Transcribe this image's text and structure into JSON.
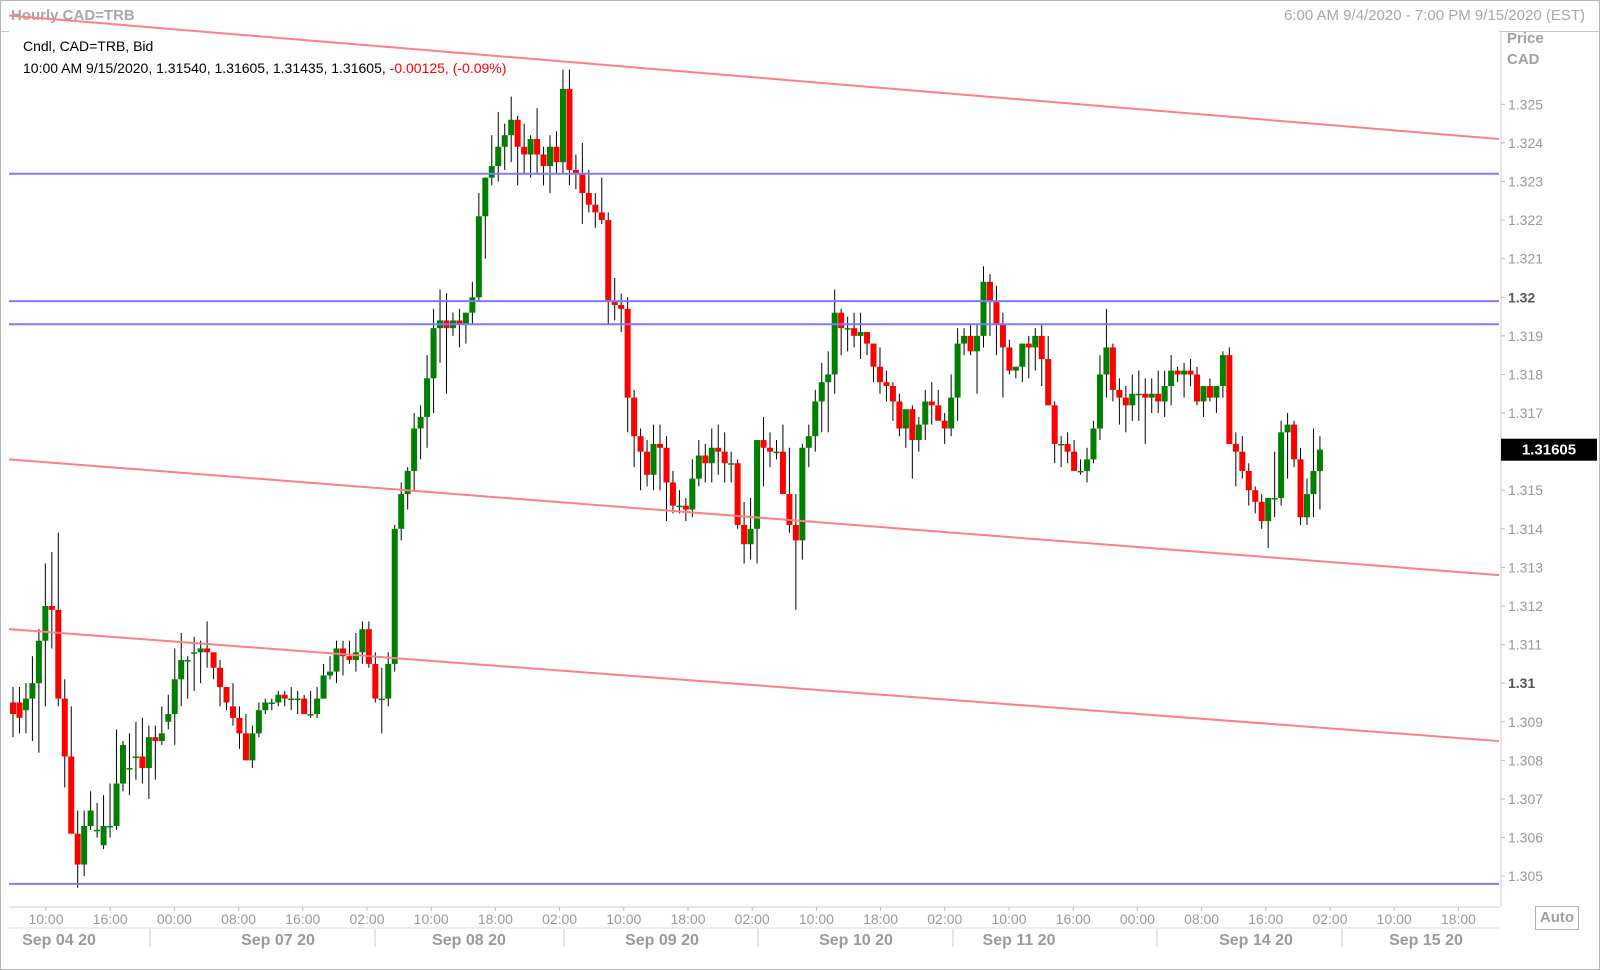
{
  "window": {
    "title": "Hourly CAD=TRB",
    "range_label": "6:00 AM 9/4/2020 - 7:00 PM 9/15/2020 (EST)"
  },
  "legend": {
    "line1": "Cndl, CAD=TRB, Bid",
    "line2_black": "10:00 AM 9/15/2020, 1.31540, 1.31605, 1.31435, 1.31605,",
    "line2_red": "-0.00125, (-0.09%)"
  },
  "axis": {
    "title_line1": "Price",
    "title_line2": "CAD",
    "last_price": "1.31605",
    "auto_label": "Auto"
  },
  "colors": {
    "up": "#008000",
    "down": "#ff0000",
    "support_line": "#7b7bff",
    "channel_line": "#ff8080",
    "last_price_bg": "#000000"
  },
  "chart_data": {
    "type": "candlestick",
    "title": "Hourly CAD=TRB",
    "ylabel": "Price CAD",
    "ylim": [
      1.3042,
      1.3269
    ],
    "y_ticks": [
      "1.305",
      "1.306",
      "1.307",
      "1.308",
      "1.309",
      "1.31",
      "1.311",
      "1.312",
      "1.313",
      "1.314",
      "1.315",
      "1.316",
      "1.317",
      "1.318",
      "1.319",
      "1.32",
      "1.321",
      "1.322",
      "1.323",
      "1.324",
      "1.325"
    ],
    "x_time_labels": [
      "10:00",
      "16:00",
      "00:00",
      "08:00",
      "16:00",
      "02:00",
      "10:00",
      "18:00",
      "02:00",
      "10:00",
      "18:00",
      "02:00",
      "10:00",
      "18:00",
      "02:00",
      "10:00",
      "16:00",
      "00:00",
      "08:00",
      "16:00",
      "02:00",
      "10:00",
      "18:00"
    ],
    "x_date_labels": [
      "Sep 04 20",
      "Sep 07 20",
      "Sep 08 20",
      "Sep 09 20",
      "Sep 10 20",
      "Sep 11 20",
      "Sep 14 20",
      "Sep 15 20"
    ],
    "horizontal_lines": [
      1.3232,
      1.3199,
      1.3193,
      1.3048
    ],
    "trend_lines": [
      {
        "start": [
          "Sep 04 08:00",
          1.3273
        ],
        "end": [
          "Sep 15 19:00",
          1.3241
        ]
      },
      {
        "start": [
          "Sep 04 08:00",
          1.3158
        ],
        "end": [
          "Sep 15 19:00",
          1.3128
        ]
      },
      {
        "start": [
          "Sep 04 08:00",
          1.3114
        ],
        "end": [
          "Sep 15 19:00",
          1.3085
        ]
      }
    ],
    "last_value": 1.31605,
    "ohlc": [
      [
        1.3095,
        1.3099,
        1.3086,
        1.3092
      ],
      [
        1.3095,
        1.3099,
        1.3087,
        1.3091
      ],
      [
        1.3093,
        1.31,
        1.3087,
        1.3096
      ],
      [
        1.3096,
        1.3107,
        1.3085,
        1.31
      ],
      [
        1.31,
        1.3114,
        1.3082,
        1.3111
      ],
      [
        1.3111,
        1.3131,
        1.3094,
        1.312
      ],
      [
        1.312,
        1.3134,
        1.3109,
        1.3119
      ],
      [
        1.3119,
        1.3139,
        1.3094,
        1.3096
      ],
      [
        1.3096,
        1.3101,
        1.3073,
        1.3081
      ],
      [
        1.3081,
        1.3094,
        1.3063,
        1.3061
      ],
      [
        1.3061,
        1.3067,
        1.3047,
        1.3053
      ],
      [
        1.3053,
        1.3067,
        1.305,
        1.3063
      ],
      [
        1.3063,
        1.3072,
        1.3062,
        1.3067
      ],
      [
        1.3062,
        1.3069,
        1.306,
        1.3062
      ],
      [
        1.3058,
        1.3071,
        1.3057,
        1.3063
      ],
      [
        1.3063,
        1.3074,
        1.306,
        1.3063
      ],
      [
        1.3063,
        1.3088,
        1.3062,
        1.3074
      ],
      [
        1.3074,
        1.3085,
        1.3072,
        1.3084
      ],
      [
        1.3078,
        1.3087,
        1.3071,
        1.3078
      ],
      [
        1.3081,
        1.309,
        1.3075,
        1.3081
      ],
      [
        1.3081,
        1.3091,
        1.3074,
        1.3078
      ],
      [
        1.3078,
        1.3089,
        1.307,
        1.3086
      ],
      [
        1.3086,
        1.3089,
        1.3075,
        1.3085
      ],
      [
        1.3085,
        1.3094,
        1.3084,
        1.3087
      ],
      [
        1.309,
        1.3097,
        1.3088,
        1.3092
      ],
      [
        1.3092,
        1.3109,
        1.3084,
        1.3101
      ],
      [
        1.3101,
        1.3113,
        1.3094,
        1.3106
      ],
      [
        1.3106,
        1.3107,
        1.3096,
        1.3106
      ],
      [
        1.3108,
        1.3112,
        1.3098,
        1.3108
      ],
      [
        1.3108,
        1.3111,
        1.31,
        1.3109
      ],
      [
        1.3109,
        1.3116,
        1.3104,
        1.3108
      ],
      [
        1.3108,
        1.3108,
        1.3101,
        1.3104
      ],
      [
        1.3104,
        1.3106,
        1.3094,
        1.3099
      ],
      [
        1.3099,
        1.3099,
        1.3093,
        1.3095
      ],
      [
        1.3094,
        1.31,
        1.3089,
        1.3091
      ],
      [
        1.3091,
        1.3094,
        1.3083,
        1.3087
      ],
      [
        1.3087,
        1.3092,
        1.308,
        1.308
      ],
      [
        1.308,
        1.3089,
        1.3078,
        1.3087
      ],
      [
        1.3087,
        1.3095,
        1.3086,
        1.3093
      ],
      [
        1.3093,
        1.3096,
        1.3092,
        1.3095
      ],
      [
        1.3095,
        1.3096,
        1.3093,
        1.3095
      ],
      [
        1.3095,
        1.3098,
        1.3094,
        1.3097
      ],
      [
        1.3097,
        1.3098,
        1.3094,
        1.3096
      ],
      [
        1.3096,
        1.3099,
        1.3093,
        1.3096
      ],
      [
        1.3096,
        1.3098,
        1.3092,
        1.3096
      ],
      [
        1.3096,
        1.3097,
        1.3092,
        1.3092
      ],
      [
        1.3092,
        1.3098,
        1.3091,
        1.3092
      ],
      [
        1.3092,
        1.3099,
        1.3091,
        1.3096
      ],
      [
        1.3096,
        1.3105,
        1.3096,
        1.3102
      ],
      [
        1.3102,
        1.3107,
        1.3101,
        1.3103
      ],
      [
        1.3103,
        1.3111,
        1.31,
        1.3109
      ],
      [
        1.3109,
        1.3111,
        1.3102,
        1.3107
      ],
      [
        1.3107,
        1.3111,
        1.3105,
        1.3106
      ],
      [
        1.3106,
        1.3113,
        1.3103,
        1.3108
      ],
      [
        1.3108,
        1.3116,
        1.3105,
        1.3114
      ],
      [
        1.3114,
        1.3116,
        1.3104,
        1.3105
      ],
      [
        1.3105,
        1.3108,
        1.3095,
        1.3096
      ],
      [
        1.3096,
        1.3104,
        1.3087,
        1.3096
      ],
      [
        1.3096,
        1.3108,
        1.3094,
        1.3105
      ],
      [
        1.3105,
        1.3141,
        1.3103,
        1.314
      ],
      [
        1.314,
        1.3152,
        1.3137,
        1.3149
      ],
      [
        1.3149,
        1.3156,
        1.3145,
        1.3155
      ],
      [
        1.3155,
        1.317,
        1.315,
        1.3166
      ],
      [
        1.3166,
        1.3172,
        1.3158,
        1.3169
      ],
      [
        1.3169,
        1.3185,
        1.3161,
        1.3179
      ],
      [
        1.3179,
        1.3197,
        1.317,
        1.3192
      ],
      [
        1.3192,
        1.3202,
        1.3183,
        1.3194
      ],
      [
        1.3194,
        1.3201,
        1.3175,
        1.3192
      ],
      [
        1.3192,
        1.3196,
        1.319,
        1.3194
      ],
      [
        1.3194,
        1.3197,
        1.3187,
        1.3193
      ],
      [
        1.3193,
        1.3196,
        1.3188,
        1.3196
      ],
      [
        1.3196,
        1.3204,
        1.3193,
        1.32
      ],
      [
        1.32,
        1.3227,
        1.3199,
        1.3221
      ],
      [
        1.3221,
        1.3231,
        1.321,
        1.3231
      ],
      [
        1.3231,
        1.3242,
        1.3229,
        1.3234
      ],
      [
        1.3234,
        1.3248,
        1.323,
        1.3239
      ],
      [
        1.3239,
        1.3245,
        1.3233,
        1.3242
      ],
      [
        1.3242,
        1.3252,
        1.3235,
        1.3246
      ],
      [
        1.3246,
        1.3247,
        1.3229,
        1.3239
      ],
      [
        1.3239,
        1.3245,
        1.3232,
        1.3237
      ],
      [
        1.3237,
        1.3242,
        1.3231,
        1.3241
      ],
      [
        1.3241,
        1.3249,
        1.3232,
        1.3237
      ],
      [
        1.3237,
        1.3239,
        1.3229,
        1.3234
      ],
      [
        1.3234,
        1.3242,
        1.3227,
        1.3239
      ],
      [
        1.3239,
        1.3243,
        1.3232,
        1.3235
      ],
      [
        1.3235,
        1.3259,
        1.3232,
        1.3254
      ],
      [
        1.3254,
        1.3259,
        1.3229,
        1.3233
      ],
      [
        1.3233,
        1.3237,
        1.3228,
        1.3232
      ],
      [
        1.3232,
        1.324,
        1.3219,
        1.3227
      ],
      [
        1.3227,
        1.3233,
        1.3222,
        1.3224
      ],
      [
        1.3224,
        1.3227,
        1.3218,
        1.3222
      ],
      [
        1.3222,
        1.3231,
        1.3219,
        1.322
      ],
      [
        1.322,
        1.3222,
        1.3193,
        1.3199
      ],
      [
        1.3199,
        1.3205,
        1.3194,
        1.3198
      ],
      [
        1.3198,
        1.3201,
        1.3191,
        1.3197
      ],
      [
        1.3197,
        1.32,
        1.3165,
        1.3174
      ],
      [
        1.3174,
        1.3176,
        1.3156,
        1.3164
      ],
      [
        1.3164,
        1.3166,
        1.315,
        1.316
      ],
      [
        1.316,
        1.3163,
        1.3151,
        1.3154
      ],
      [
        1.3154,
        1.3167,
        1.315,
        1.3162
      ],
      [
        1.3162,
        1.3167,
        1.315,
        1.3161
      ],
      [
        1.3161,
        1.3164,
        1.3142,
        1.3152
      ],
      [
        1.3152,
        1.3155,
        1.3144,
        1.3146
      ],
      [
        1.3146,
        1.315,
        1.3144,
        1.3146
      ],
      [
        1.3146,
        1.3148,
        1.3142,
        1.3145
      ],
      [
        1.3145,
        1.3158,
        1.3143,
        1.3153
      ],
      [
        1.3153,
        1.3163,
        1.3151,
        1.3159
      ],
      [
        1.3159,
        1.3162,
        1.3152,
        1.3157
      ],
      [
        1.3157,
        1.3166,
        1.3152,
        1.3161
      ],
      [
        1.3161,
        1.3167,
        1.3154,
        1.316
      ],
      [
        1.316,
        1.3165,
        1.3152,
        1.3157
      ],
      [
        1.3157,
        1.316,
        1.3152,
        1.3157
      ],
      [
        1.3157,
        1.3158,
        1.314,
        1.3141
      ],
      [
        1.3141,
        1.3147,
        1.3131,
        1.3136
      ],
      [
        1.3136,
        1.3148,
        1.3132,
        1.314
      ],
      [
        1.314,
        1.3152,
        1.3131,
        1.3163
      ],
      [
        1.3163,
        1.3169,
        1.3151,
        1.3161
      ],
      [
        1.3161,
        1.3165,
        1.3156,
        1.316
      ],
      [
        1.316,
        1.3163,
        1.3158,
        1.316
      ],
      [
        1.316,
        1.3167,
        1.3151,
        1.3149
      ],
      [
        1.3149,
        1.3161,
        1.3139,
        1.3141
      ],
      [
        1.3141,
        1.3149,
        1.3119,
        1.3137
      ],
      [
        1.3137,
        1.3162,
        1.3132,
        1.3161
      ],
      [
        1.3161,
        1.3167,
        1.3156,
        1.3164
      ],
      [
        1.3164,
        1.3176,
        1.316,
        1.3173
      ],
      [
        1.3173,
        1.3183,
        1.3165,
        1.3178
      ],
      [
        1.3178,
        1.3186,
        1.3165,
        1.318
      ],
      [
        1.318,
        1.3202,
        1.3175,
        1.3196
      ],
      [
        1.3196,
        1.3197,
        1.3185,
        1.3192
      ],
      [
        1.3192,
        1.3195,
        1.3186,
        1.3192
      ],
      [
        1.3192,
        1.3196,
        1.3187,
        1.319
      ],
      [
        1.319,
        1.3196,
        1.3184,
        1.3191
      ],
      [
        1.3191,
        1.3191,
        1.3185,
        1.3188
      ],
      [
        1.3188,
        1.3188,
        1.3178,
        1.3182
      ],
      [
        1.3182,
        1.3187,
        1.3175,
        1.3178
      ],
      [
        1.3178,
        1.3181,
        1.3173,
        1.3177
      ],
      [
        1.3177,
        1.3178,
        1.3168,
        1.3173
      ],
      [
        1.3173,
        1.3175,
        1.3164,
        1.3166
      ],
      [
        1.3166,
        1.317,
        1.3161,
        1.3171
      ],
      [
        1.3171,
        1.3172,
        1.3153,
        1.3163
      ],
      [
        1.3163,
        1.3169,
        1.316,
        1.3167
      ],
      [
        1.3167,
        1.3176,
        1.3163,
        1.3173
      ],
      [
        1.3173,
        1.3178,
        1.3167,
        1.3172
      ],
      [
        1.3172,
        1.3176,
        1.3168,
        1.3168
      ],
      [
        1.3168,
        1.317,
        1.3162,
        1.3166
      ],
      [
        1.3166,
        1.318,
        1.3164,
        1.3174
      ],
      [
        1.3174,
        1.3192,
        1.3168,
        1.3188
      ],
      [
        1.3188,
        1.3192,
        1.3185,
        1.319
      ],
      [
        1.319,
        1.3193,
        1.3185,
        1.3186
      ],
      [
        1.3186,
        1.3193,
        1.3175,
        1.319
      ],
      [
        1.319,
        1.3208,
        1.3187,
        1.3204
      ],
      [
        1.3204,
        1.3206,
        1.319,
        1.3199
      ],
      [
        1.3199,
        1.3203,
        1.3185,
        1.3193
      ],
      [
        1.3193,
        1.3196,
        1.3174,
        1.3187
      ],
      [
        1.3187,
        1.3189,
        1.318,
        1.3181
      ],
      [
        1.3181,
        1.3182,
        1.3179,
        1.3182
      ],
      [
        1.3182,
        1.3188,
        1.3178,
        1.3188
      ],
      [
        1.3188,
        1.319,
        1.3179,
        1.3187
      ],
      [
        1.3187,
        1.3192,
        1.3181,
        1.319
      ],
      [
        1.319,
        1.3193,
        1.3177,
        1.3184
      ],
      [
        1.3184,
        1.319,
        1.3173,
        1.3172
      ],
      [
        1.3172,
        1.3173,
        1.3157,
        1.3162
      ],
      [
        1.3162,
        1.3164,
        1.3156,
        1.3162
      ],
      [
        1.3162,
        1.3165,
        1.3157,
        1.316
      ],
      [
        1.316,
        1.3163,
        1.3156,
        1.3155
      ],
      [
        1.3155,
        1.3158,
        1.3154,
        1.3155
      ],
      [
        1.3155,
        1.3161,
        1.3152,
        1.3158
      ],
      [
        1.3158,
        1.3168,
        1.3157,
        1.3166
      ],
      [
        1.3166,
        1.3185,
        1.3163,
        1.318
      ],
      [
        1.318,
        1.3197,
        1.3174,
        1.3187
      ],
      [
        1.3187,
        1.3188,
        1.3173,
        1.3176
      ],
      [
        1.3176,
        1.3179,
        1.3167,
        1.3174
      ],
      [
        1.3174,
        1.3177,
        1.3165,
        1.3172
      ],
      [
        1.3172,
        1.318,
        1.3168,
        1.3175
      ],
      [
        1.3175,
        1.3181,
        1.3168,
        1.3175
      ],
      [
        1.3175,
        1.3179,
        1.3162,
        1.3174
      ],
      [
        1.3174,
        1.3179,
        1.317,
        1.3175
      ],
      [
        1.3175,
        1.3181,
        1.317,
        1.3173
      ],
      [
        1.3173,
        1.3181,
        1.3169,
        1.3177
      ],
      [
        1.3177,
        1.3185,
        1.3172,
        1.3181
      ],
      [
        1.3181,
        1.3182,
        1.3178,
        1.318
      ],
      [
        1.318,
        1.3183,
        1.3174,
        1.3181
      ],
      [
        1.3181,
        1.3184,
        1.3177,
        1.318
      ],
      [
        1.318,
        1.3182,
        1.3172,
        1.3173
      ],
      [
        1.3173,
        1.3177,
        1.3169,
        1.3177
      ],
      [
        1.3177,
        1.3179,
        1.3173,
        1.3174
      ],
      [
        1.3174,
        1.3177,
        1.317,
        1.3177
      ],
      [
        1.3177,
        1.3186,
        1.3174,
        1.3185
      ],
      [
        1.3185,
        1.3187,
        1.3162,
        1.3162
      ],
      [
        1.3162,
        1.3165,
        1.3151,
        1.316
      ],
      [
        1.316,
        1.3164,
        1.3153,
        1.3155
      ],
      [
        1.3155,
        1.3157,
        1.3146,
        1.315
      ],
      [
        1.315,
        1.3151,
        1.3144,
        1.3147
      ],
      [
        1.3147,
        1.3149,
        1.314,
        1.3142
      ],
      [
        1.3142,
        1.3145,
        1.3135,
        1.3148
      ],
      [
        1.3148,
        1.316,
        1.3143,
        1.3148
      ],
      [
        1.3148,
        1.3168,
        1.3146,
        1.3165
      ],
      [
        1.3165,
        1.317,
        1.3153,
        1.3167
      ],
      [
        1.3167,
        1.3168,
        1.3156,
        1.3158
      ],
      [
        1.3158,
        1.3161,
        1.3141,
        1.3143
      ],
      [
        1.3143,
        1.3153,
        1.3141,
        1.3149
      ],
      [
        1.3149,
        1.3166,
        1.3143,
        1.3155
      ],
      [
        1.3155,
        1.3164,
        1.3145,
        1.31605
      ]
    ]
  }
}
